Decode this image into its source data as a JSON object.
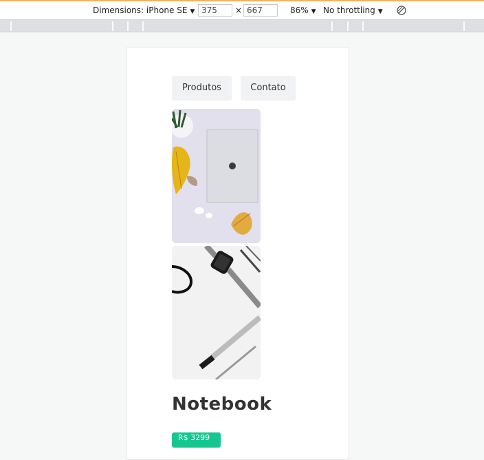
{
  "devtools": {
    "dimensions_label": "Dimensions: iPhone SE",
    "width_value": "375",
    "times_sign": "×",
    "height_value": "667",
    "zoom_label": "86%",
    "throttling_label": "No throttling",
    "caret": "▼"
  },
  "page": {
    "nav": {
      "produtos_label": "Produtos",
      "contato_label": "Contato"
    },
    "product": {
      "title": "Notebook",
      "price": "R$ 3299"
    }
  },
  "colors": {
    "accent": "#16c68f",
    "devtools_highlight": "#f2b35b"
  }
}
